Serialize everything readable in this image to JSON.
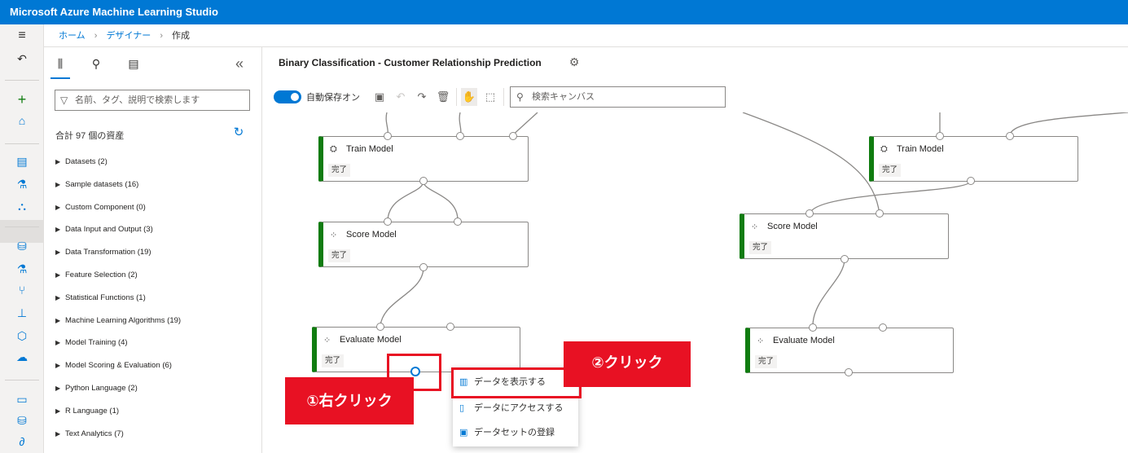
{
  "app": {
    "title": "Microsoft Azure Machine Learning Studio"
  },
  "breadcrumb": [
    "ホーム",
    "デザイナー",
    "作成"
  ],
  "panel": {
    "search_placeholder": "名前、タグ、説明で検索します",
    "total_label": "合計 97 個の資産",
    "items": [
      "Datasets (2)",
      "Sample datasets (16)",
      "Custom Component (0)",
      "Data Input and Output (3)",
      "Data Transformation (19)",
      "Feature Selection (2)",
      "Statistical Functions (1)",
      "Machine Learning Algorithms (19)",
      "Model Training (4)",
      "Model Scoring & Evaluation (6)",
      "Python Language (2)",
      "R Language (1)",
      "Text Analytics (7)"
    ]
  },
  "canvas": {
    "title": "Binary Classification - Customer Relationship Prediction",
    "autosave_label": "自動保存オン",
    "search_placeholder": "検索キャンバス"
  },
  "nodes": {
    "train_left": {
      "title": "Train Model",
      "status": "完了"
    },
    "score_left": {
      "title": "Score Model",
      "status": "完了"
    },
    "evaluate_left": {
      "title": "Evaluate Model",
      "status": "完了"
    },
    "train_right": {
      "title": "Train Model",
      "status": "完了"
    },
    "score_right": {
      "title": "Score Model",
      "status": "完了"
    },
    "evaluate_right": {
      "title": "Evaluate Model",
      "status": "完了"
    }
  },
  "context_menu": {
    "items": [
      "データを表示する",
      "データにアクセスする",
      "データセットの登録"
    ]
  },
  "callouts": {
    "step1": "①右クリック",
    "step2": "②クリック"
  },
  "colors": {
    "brand": "#0078d4",
    "success": "#107c10",
    "callout": "#e81123"
  }
}
